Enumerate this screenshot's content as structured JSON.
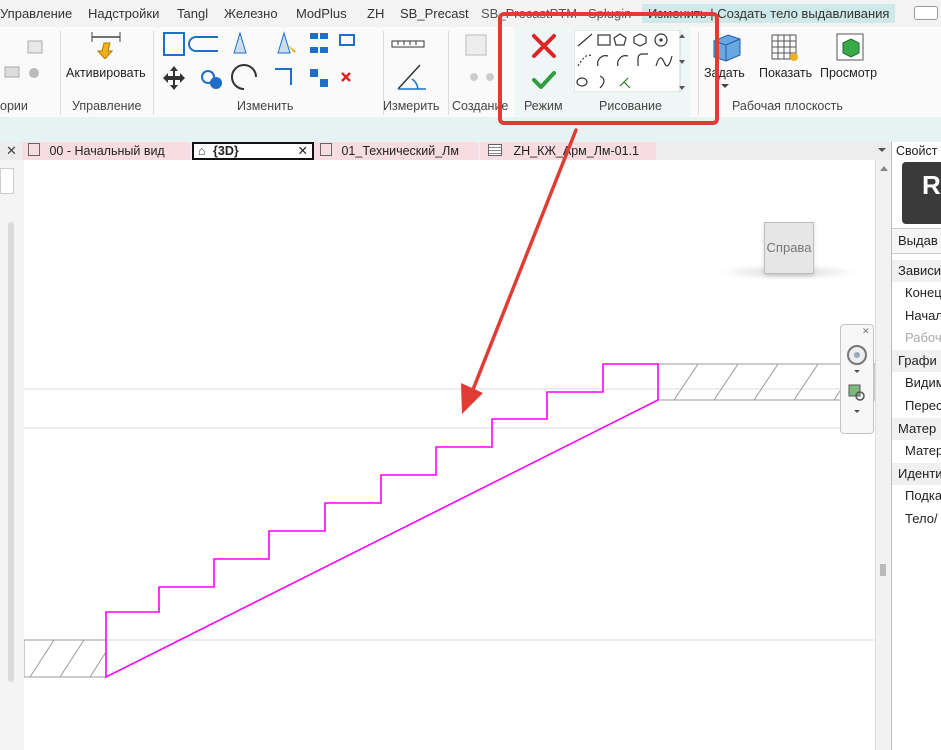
{
  "ribbon_tabs": [
    {
      "label": "Управление",
      "active": false
    },
    {
      "label": "Надстройки",
      "active": false
    },
    {
      "label": "Tangl",
      "active": false
    },
    {
      "label": "Железно",
      "active": false
    },
    {
      "label": "ModPlus",
      "active": false
    },
    {
      "label": "ZH",
      "active": false
    },
    {
      "label": "SB_Precast",
      "active": false
    },
    {
      "label": "SB_PrecastPTM",
      "active": false
    },
    {
      "label": "Splugin",
      "active": false
    },
    {
      "label": "Изменить | Создать тело выдавливания",
      "active": true
    }
  ],
  "ribbon": {
    "panels": {
      "partial_left": "ории",
      "control": "Управление",
      "modify": "Изменить",
      "measure": "Измерить",
      "create": "Создание",
      "mode": "Режим",
      "draw": "Рисование",
      "workplane": "Рабочая плоскость"
    },
    "buttons": {
      "activate": "Активировать",
      "set": "Задать",
      "show": "Показать",
      "viewer": "Просмотр"
    }
  },
  "doc_tabs": [
    {
      "label": "00 - Начальный вид",
      "active": false
    },
    {
      "label": "{3D}",
      "active": true
    },
    {
      "label": "01_Технический_Лм",
      "active": false
    },
    {
      "label": "ZH_КЖ_Арм_Лм-01.1",
      "active": false
    }
  ],
  "viewcube_label": "Справа",
  "properties": {
    "header": "Свойст",
    "logo": "R",
    "type_selector": "Выдав",
    "rows": [
      {
        "text": "Зависи",
        "group": true,
        "dim": false
      },
      {
        "text": "Конец",
        "group": false,
        "dim": false
      },
      {
        "text": "Начал",
        "group": false,
        "dim": false
      },
      {
        "text": "Рабоч",
        "group": false,
        "dim": true
      },
      {
        "text": "Графи",
        "group": true,
        "dim": false
      },
      {
        "text": "Видим",
        "group": false,
        "dim": false
      },
      {
        "text": "Перес",
        "group": false,
        "dim": false
      },
      {
        "text": "Матер",
        "group": true,
        "dim": false
      },
      {
        "text": "Матер",
        "group": false,
        "dim": false
      },
      {
        "text": "Иденти",
        "group": true,
        "dim": false
      },
      {
        "text": "Подка",
        "group": false,
        "dim": false
      },
      {
        "text": "Тело/",
        "group": false,
        "dim": false
      }
    ]
  },
  "colors": {
    "sketch": "#ff00ff",
    "highlight": "#e03c35",
    "accent_tab": "#cfe9ea",
    "doc_tab_pink": "#f7dde3"
  }
}
